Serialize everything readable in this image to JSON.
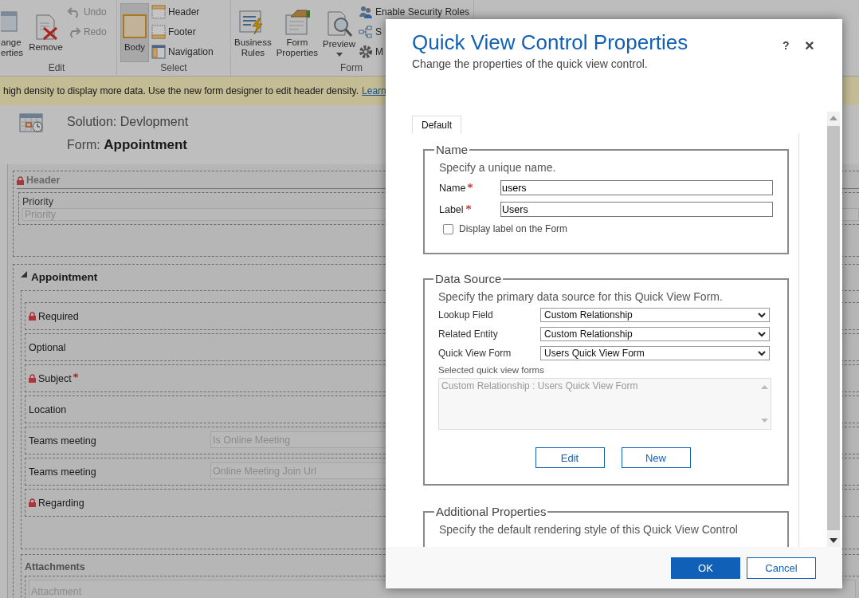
{
  "ribbon": {
    "groups": [
      {
        "label": "Edit",
        "large": [
          {
            "lines": [
              "ange",
              "erties"
            ],
            "selected": false,
            "dropdown": false
          },
          {
            "lines": [
              "Remove"
            ],
            "selected": false,
            "dropdown": false
          }
        ],
        "small": [
          {
            "label": "Undo",
            "disabled": true
          },
          {
            "label": "Redo",
            "disabled": true
          }
        ]
      },
      {
        "label": "Select",
        "large": [
          {
            "lines": [
              "Body"
            ],
            "selected": true,
            "dropdown": false
          }
        ],
        "small": [
          {
            "label": "Header",
            "disabled": false
          },
          {
            "label": "Footer",
            "disabled": false
          },
          {
            "label": "Navigation",
            "disabled": false
          }
        ]
      },
      {
        "label": "Form",
        "large": [
          {
            "lines": [
              "Business",
              "Rules"
            ],
            "selected": false,
            "dropdown": false
          },
          {
            "lines": [
              "Form",
              "Properties"
            ],
            "selected": false,
            "dropdown": false
          },
          {
            "lines": [
              "Preview"
            ],
            "selected": false,
            "dropdown": true
          }
        ],
        "small": [
          {
            "label": "Enable Security Roles",
            "disabled": false
          },
          {
            "label": "S",
            "disabled": false
          },
          {
            "label": "M",
            "disabled": false
          }
        ]
      }
    ]
  },
  "banner": {
    "text": "high density to display more data. Use the new form designer to edit header density.",
    "link": "Learn"
  },
  "form": {
    "solution": "Solution: Devlopment",
    "title": "Form: **Appointment**",
    "header": {
      "title": "Header",
      "locked": true,
      "fields": [
        {
          "label": "Priority",
          "placeholder": "Priority"
        }
      ]
    },
    "appointment": {
      "title": "Appointment",
      "expanded": true,
      "fields": [
        {
          "label": "Required",
          "locked": true,
          "required": false
        },
        {
          "label": "Optional",
          "locked": false,
          "required": false
        },
        {
          "label": "Subject",
          "locked": true,
          "required": true
        },
        {
          "label": "Location",
          "locked": false,
          "required": false
        },
        {
          "label": "Teams meeting",
          "locked": false,
          "required": false,
          "placeholder": "Is Online Meeting"
        },
        {
          "label": "Teams meeting",
          "locked": false,
          "required": false,
          "placeholder": "Online Meeting Join Url"
        },
        {
          "label": "Regarding",
          "locked": true,
          "required": false
        }
      ]
    },
    "attachments": {
      "title": "Attachments",
      "placeholder": "Attachment"
    }
  },
  "dialog": {
    "title": "Quick View Control Properties",
    "subtitle": "Change the properties of the quick view control.",
    "help": "?",
    "close": "×",
    "tabs": [
      {
        "label": "Default",
        "selected": true
      }
    ],
    "name_section": {
      "legend": "Name",
      "hint": "Specify a unique name.",
      "fields": [
        {
          "label": "Name",
          "required": true,
          "value": "users"
        },
        {
          "label": "Label",
          "required": true,
          "value": "Users"
        }
      ],
      "checkbox": {
        "label": "Display label on the Form",
        "checked": false
      }
    },
    "data_source": {
      "legend": "Data Source",
      "hint": "Specify the primary data source for this Quick View Form.",
      "selects": [
        {
          "label": "Lookup Field",
          "value": "Custom Relationship"
        },
        {
          "label": "Related Entity",
          "value": "Custom Relationship"
        },
        {
          "label": "Quick View Form",
          "value": "Users Quick View Form"
        }
      ],
      "list_label": "Selected quick view forms",
      "list_items": [
        "Custom Relationship : Users Quick View Form"
      ],
      "buttons": [
        "Edit",
        "New"
      ]
    },
    "additional": {
      "legend": "Additional Properties",
      "hint": "Specify the default rendering style of this Quick View Control"
    },
    "footer_buttons": [
      {
        "label": "OK",
        "kind": "primary"
      },
      {
        "label": "Cancel",
        "kind": "secondary"
      }
    ]
  }
}
